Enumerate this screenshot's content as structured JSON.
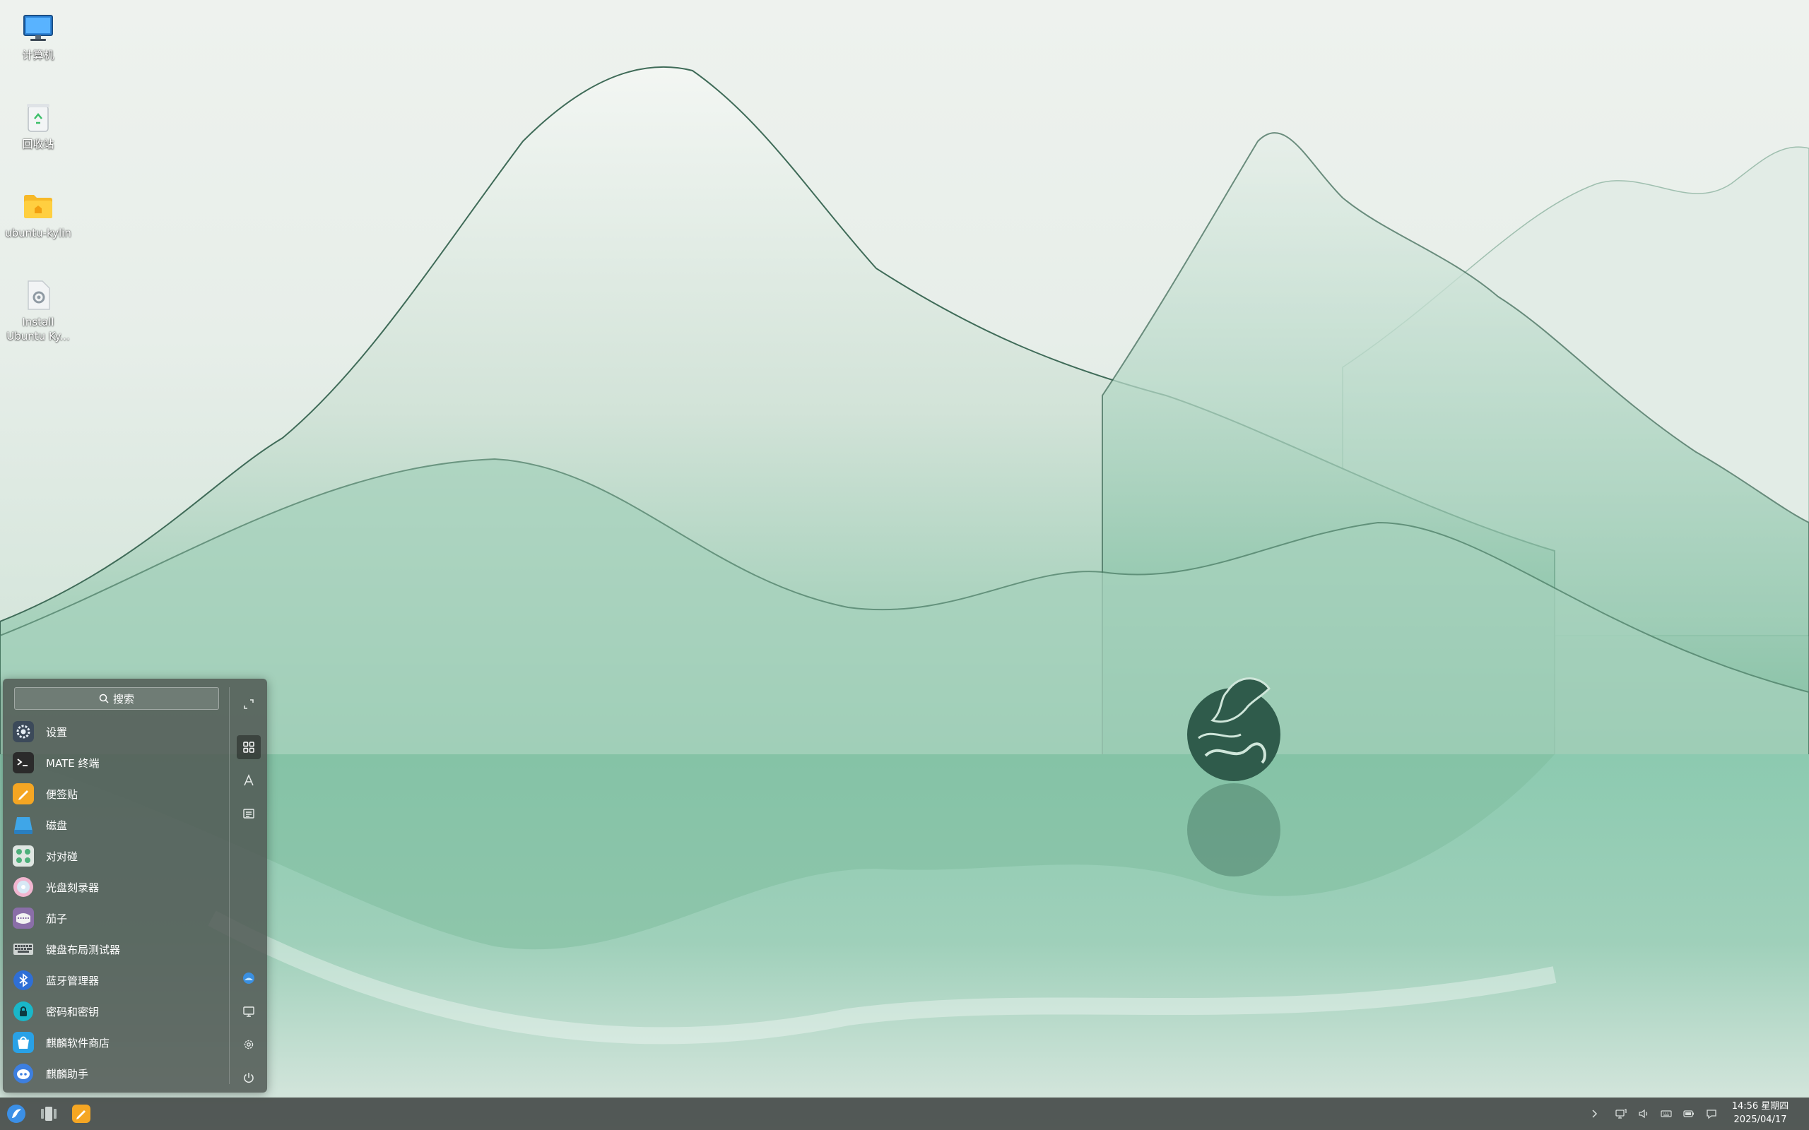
{
  "desktop": {
    "icons": [
      {
        "label": "计算机",
        "icon": "computer-icon"
      },
      {
        "label": "回收站",
        "icon": "trash-icon"
      },
      {
        "label": "ubuntu-kylin",
        "icon": "folder-icon"
      },
      {
        "label": "Install Ubuntu Ky...",
        "icon": "installer-icon"
      }
    ]
  },
  "start_menu": {
    "search_label": "搜索",
    "apps": [
      {
        "label": "设置",
        "icon": "settings-icon",
        "color": "#3c4a5a"
      },
      {
        "label": "MATE 终端",
        "icon": "terminal-icon",
        "color": "#2b2b2b"
      },
      {
        "label": "便签贴",
        "icon": "sticky-notes-icon",
        "color": "#f5a623"
      },
      {
        "label": "磁盘",
        "icon": "disk-icon",
        "color": "#3fa6e8"
      },
      {
        "label": "对对碰",
        "icon": "game-icon",
        "color": "#dfe6e2"
      },
      {
        "label": "光盘刻录器",
        "icon": "disc-burner-icon",
        "color": "#f1b6d0"
      },
      {
        "label": "茄子",
        "icon": "cheese-icon",
        "color": "#8a6ea8"
      },
      {
        "label": "键盘布局测试器",
        "icon": "keyboard-icon",
        "color": "#cfd4d2"
      },
      {
        "label": "蓝牙管理器",
        "icon": "bluetooth-icon",
        "color": "#2f6fd6"
      },
      {
        "label": "密码和密钥",
        "icon": "key-icon",
        "color": "#19b7c9"
      },
      {
        "label": "麒麟软件商店",
        "icon": "software-store-icon",
        "color": "#29a1e6"
      },
      {
        "label": "麒麟助手",
        "icon": "assistant-icon",
        "color": "#3d7fe0"
      }
    ],
    "side_buttons": [
      {
        "name": "expand-icon"
      },
      {
        "name": "all-apps-icon",
        "active": true
      },
      {
        "name": "alphabet-icon"
      },
      {
        "name": "category-icon"
      },
      {
        "name": "user-avatar-icon"
      },
      {
        "name": "computer-icon"
      },
      {
        "name": "settings-icon"
      },
      {
        "name": "power-icon"
      }
    ]
  },
  "taskbar": {
    "clock_time": "14:56 星期四",
    "clock_date": "2025/04/17"
  },
  "colors": {
    "menu_bg": "#50584f",
    "taskbar_bg": "#464c4a",
    "wallpaper_green": "#7fbfa0"
  }
}
